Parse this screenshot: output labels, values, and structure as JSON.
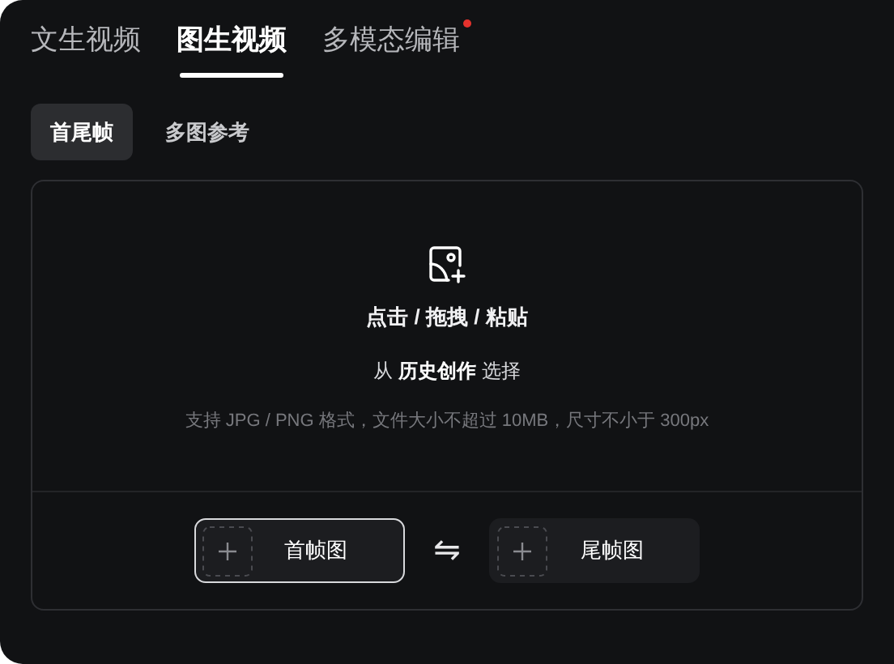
{
  "tabs": [
    {
      "label": "文生视频",
      "selected": false,
      "dot": false
    },
    {
      "label": "图生视频",
      "selected": true,
      "dot": false
    },
    {
      "label": "多模态编辑",
      "selected": false,
      "dot": true
    }
  ],
  "sub_tabs": [
    {
      "label": "首尾帧",
      "selected": true
    },
    {
      "label": "多图参考",
      "selected": false
    }
  ],
  "upload": {
    "title": "点击 / 拖拽 / 粘贴",
    "history": "从 **历史创作** 选择",
    "hint": "支持 JPG / PNG 格式，文件大小不超过 10MB，尺寸不小于 300px"
  },
  "frames": [
    {
      "label": "首帧图",
      "selected": true
    },
    {
      "label": "尾帧图",
      "selected": false
    }
  ],
  "swap": "⇋"
}
